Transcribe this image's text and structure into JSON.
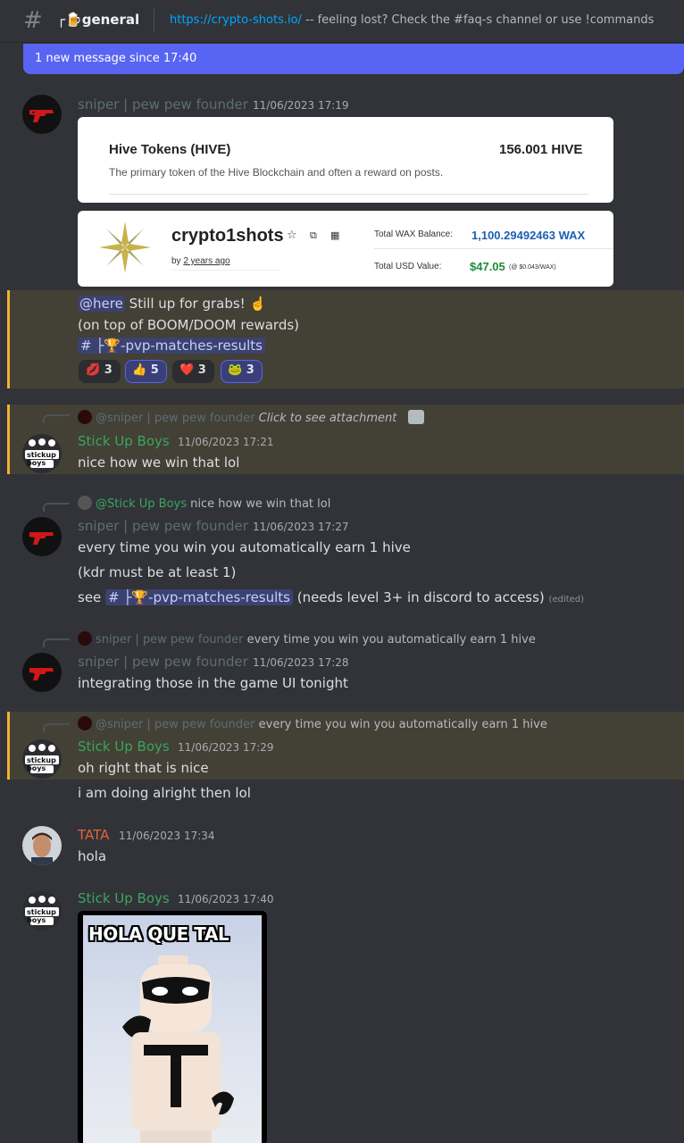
{
  "header": {
    "hash": "#",
    "channel_name": "┌🍺general",
    "topic_link": "https://crypto-shots.io/",
    "topic_rest": " -- feeling lost? Check the #faq-s channel or use !commands"
  },
  "new_message_bar": "1 new message since 17:40",
  "msg1": {
    "username": "sniper | pew pew founder",
    "timestamp": "11/06/2023 17:19",
    "embed1": {
      "title": "Hive Tokens (HIVE)",
      "amount": "156.001 HIVE",
      "desc": "The primary token of the Hive Blockchain and often a reward on posts."
    },
    "embed2": {
      "name": "crypto1shots",
      "by": "by",
      "age": "2 years ago",
      "wax_label": "Total WAX Balance:",
      "wax_value": "1,100.29492463 WAX",
      "usd_label": "Total USD Value:",
      "usd_value": "$47.05",
      "usd_note": "(@ $0.043/WAX)"
    },
    "line1_mention": "@here",
    "line1_text": " Still up for grabs! ☝️",
    "line2": "(on top of BOOM/DOOM rewards)",
    "line3_channel": "# ├🏆-pvp-matches-results",
    "reactions": [
      {
        "emoji": "💋",
        "count": "3"
      },
      {
        "emoji": "👍",
        "count": "5"
      },
      {
        "emoji": "❤️",
        "count": "3"
      },
      {
        "emoji": "🐸",
        "count": "3"
      }
    ]
  },
  "msg2": {
    "reply_name": "@sniper | pew pew founder",
    "reply_text": "Click to see attachment",
    "username": "Stick Up Boys",
    "timestamp": "11/06/2023 17:21",
    "text": "nice how we win that lol"
  },
  "msg3": {
    "reply_name": "@Stick Up Boys",
    "reply_text": "nice how we win that lol",
    "username": "sniper | pew pew founder",
    "timestamp": "11/06/2023 17:27",
    "line1": "every time you win you automatically earn 1 hive",
    "line2": "(kdr must be at least 1)",
    "line3_pre": "see ",
    "line3_channel": "# ├🏆-pvp-matches-results",
    "line3_post": "  (needs level 3+ in discord to access) ",
    "edited": "(edited)"
  },
  "msg4": {
    "reply_name": "sniper | pew pew founder",
    "reply_text": "every time you win you automatically earn 1 hive",
    "username": "sniper | pew pew founder",
    "timestamp": "11/06/2023 17:28",
    "text": "integrating those in the game UI tonight"
  },
  "msg5": {
    "reply_name": "@sniper | pew pew founder",
    "reply_text": "every time you win you automatically earn 1 hive",
    "username": "Stick Up Boys",
    "timestamp": "11/06/2023 17:29",
    "text": "oh right that is nice",
    "text2": "i am doing alright then lol"
  },
  "msg6": {
    "username": "TATA",
    "timestamp": "11/06/2023 17:34",
    "text": "hola"
  },
  "msg7": {
    "username": "Stick Up Boys",
    "timestamp": "11/06/2023 17:40",
    "image_caption": "HOLA QUE TAL"
  },
  "avatar_text": "stickup boys",
  "colors": {
    "accent": "#5865f2",
    "sniper": "#5d6d78",
    "stick": "#3ba55d",
    "tata": "#e0663c",
    "highlight_border": "#f0b232"
  }
}
